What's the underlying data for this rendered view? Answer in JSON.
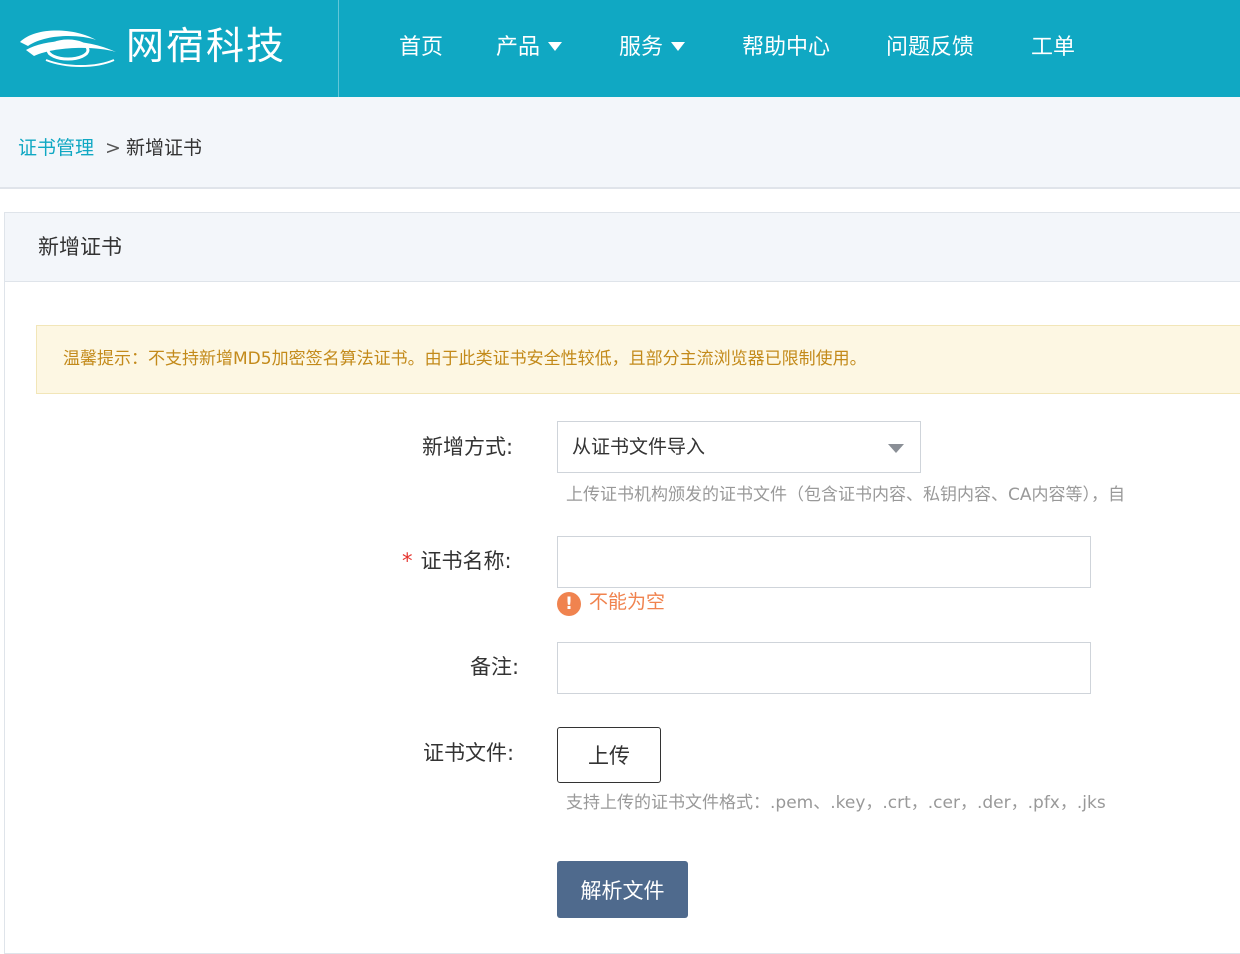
{
  "brand": {
    "name": "网宿科技",
    "logo_icon": "wangsu-swirl-logo-icon"
  },
  "nav": {
    "items": [
      {
        "label": "首页",
        "has_dropdown": false
      },
      {
        "label": "产品",
        "has_dropdown": true
      },
      {
        "label": "服务",
        "has_dropdown": true
      },
      {
        "label": "帮助中心",
        "has_dropdown": false
      },
      {
        "label": "问题反馈",
        "has_dropdown": false
      },
      {
        "label": "工单",
        "has_dropdown": false
      }
    ]
  },
  "breadcrumb": {
    "parent": "证书管理",
    "separator": ">",
    "current": "新增证书"
  },
  "panel": {
    "title": "新增证书"
  },
  "tip": {
    "text": "温馨提示：不支持新增MD5加密签名算法证书。由于此类证书安全性较低，且部分主流浏览器已限制使用。"
  },
  "form": {
    "method": {
      "label": "新增方式:",
      "value": "从证书文件导入",
      "hint": "上传证书机构颁发的证书文件（包含证书内容、私钥内容、CA内容等），自"
    },
    "name": {
      "required_mark": "*",
      "label": "证书名称:",
      "value": "",
      "error_icon": "exclamation-circle-icon",
      "error": "不能为空"
    },
    "remark": {
      "label": "备注:",
      "value": ""
    },
    "file": {
      "label": "证书文件:",
      "upload_label": "上传",
      "hint": "支持上传的证书文件格式：.pem、.key，.crt，.cer，.der，.pfx，.jks"
    },
    "submit_label": "解析文件"
  },
  "colors": {
    "header": "#10a8c3",
    "tip_text": "#c38a1a",
    "tip_bg": "#fdf7e3",
    "error": "#f0834f",
    "primary_button": "#4f6a8d",
    "breadcrumb_link": "#10a8c3"
  }
}
